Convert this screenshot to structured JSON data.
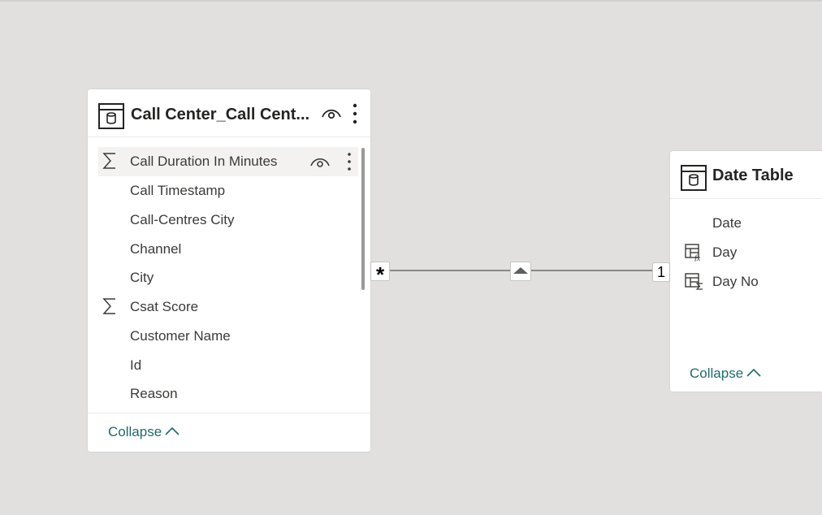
{
  "tables": {
    "left": {
      "title": "Call Center_Call Cent...",
      "fields": [
        {
          "name": "Call Duration In Minutes",
          "icon": "sigma-icon"
        },
        {
          "name": "Call Timestamp",
          "icon": ""
        },
        {
          "name": "Call-Centres City",
          "icon": ""
        },
        {
          "name": "Channel",
          "icon": ""
        },
        {
          "name": "City",
          "icon": ""
        },
        {
          "name": "Csat Score",
          "icon": "sigma-icon"
        },
        {
          "name": "Customer Name",
          "icon": ""
        },
        {
          "name": "Id",
          "icon": ""
        },
        {
          "name": "Reason",
          "icon": ""
        }
      ],
      "collapse_label": "Collapse"
    },
    "right": {
      "title": "Date Table",
      "fields": [
        {
          "name": "Date",
          "icon": ""
        },
        {
          "name": "Day",
          "icon": "calculated-column-icon"
        },
        {
          "name": "Day No",
          "icon": "calculated-sum-icon"
        }
      ],
      "collapse_label": "Collapse"
    }
  },
  "relationship": {
    "from_cardinality": "*",
    "to_cardinality": "1",
    "direction": "single"
  },
  "colors": {
    "canvas": "#e1e0de",
    "collapse_link": "#1f6a6c",
    "line": "#8a8886"
  }
}
